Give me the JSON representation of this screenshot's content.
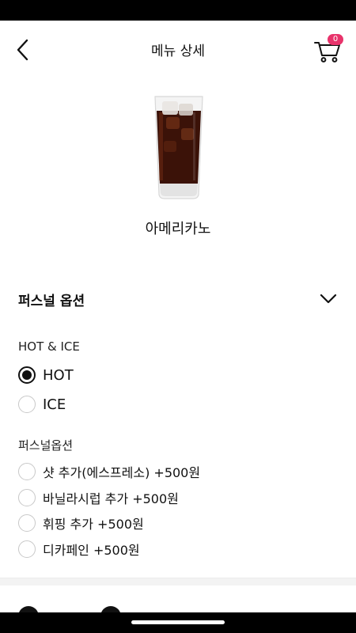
{
  "header": {
    "title": "메뉴 상세",
    "back_icon": "chevron-left-icon",
    "cart_icon": "cart-icon",
    "cart_count": "0"
  },
  "product": {
    "name": "아메리카노",
    "image": "iced-americano-glass"
  },
  "personal_option_section": {
    "title": "퍼스널 옵션",
    "toggle_icon": "chevron-down-icon"
  },
  "temperature": {
    "title": "HOT & ICE",
    "options": [
      {
        "label": "HOT",
        "selected": true
      },
      {
        "label": "ICE",
        "selected": false
      }
    ]
  },
  "extras": {
    "title": "퍼스널옵션",
    "options": [
      {
        "label": "샷 추가(에스프레소) +500원",
        "selected": false
      },
      {
        "label": "바닐라시럽 추가 +500원",
        "selected": false
      },
      {
        "label": "휘핑 추가 +500원",
        "selected": false
      },
      {
        "label": "디카페인 +500원",
        "selected": false
      }
    ]
  },
  "colors": {
    "accent": "#e8336b",
    "text": "#111111",
    "radio_border": "#c8c8c8"
  }
}
